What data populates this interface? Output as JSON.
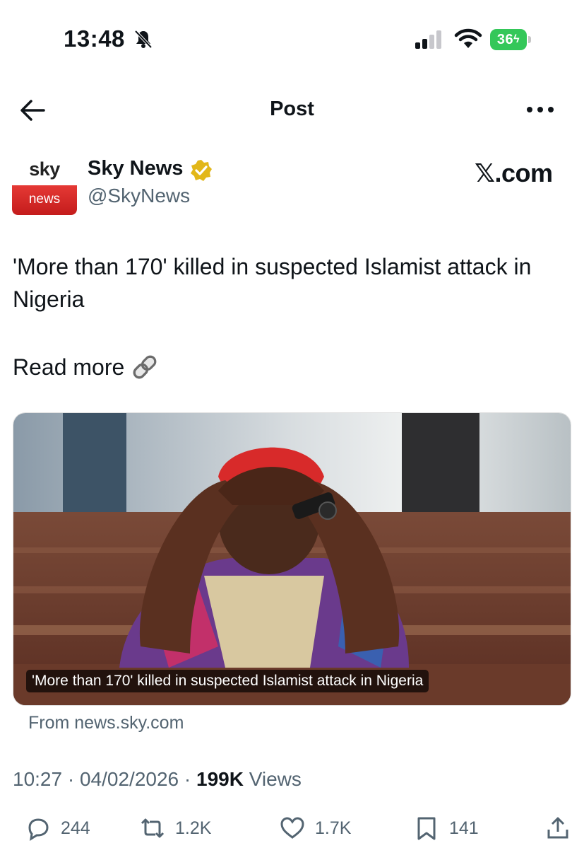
{
  "status_bar": {
    "time": "13:48",
    "battery_level": "36"
  },
  "header": {
    "title": "Post"
  },
  "author": {
    "avatar_top": "sky",
    "avatar_bottom": "news",
    "name": "Sky News",
    "handle": "@SkyNews",
    "watermark": "𝕏.com"
  },
  "tweet": {
    "text": "'More than 170' killed in suspected Islamist attack in Nigeria",
    "read_more": "Read more"
  },
  "media": {
    "caption": "'More than 170' killed in suspected Islamist attack in Nigeria",
    "source": "From news.sky.com"
  },
  "meta": {
    "time": "10:27",
    "separator": "·",
    "date": "04/02/2026",
    "views_count": "199K",
    "views_label": "Views"
  },
  "actions": {
    "replies": "244",
    "reposts": "1.2K",
    "likes": "1.7K",
    "bookmarks": "141"
  },
  "colors": {
    "accent_gray": "#536471",
    "verified_gold": "#e2b719",
    "sky_red": "#d32f2f",
    "battery_green": "#34c759"
  }
}
